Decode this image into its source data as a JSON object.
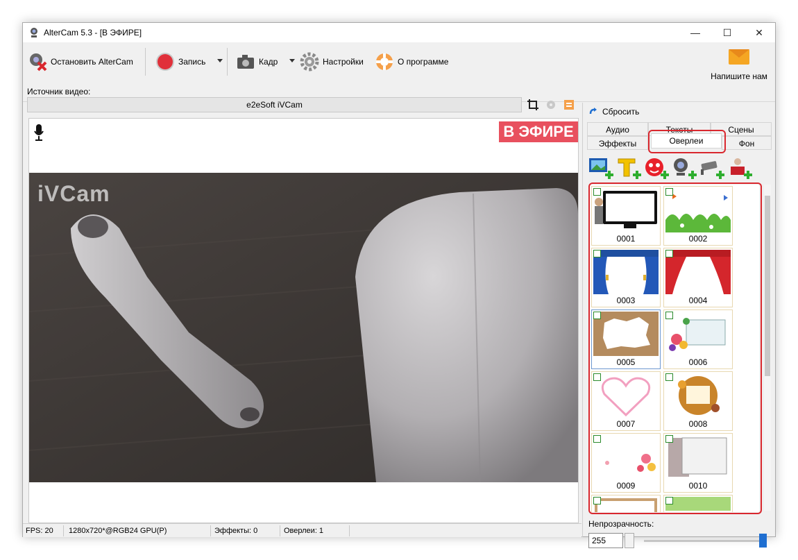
{
  "window": {
    "title": "AlterCam 5.3 - [В ЭФИРЕ]",
    "controls": {
      "minimize": "—",
      "maximize": "☐",
      "close": "✕"
    }
  },
  "toolbar": {
    "stop_label": "Остановить AlterCam",
    "record_label": "Запись",
    "frame_label": "Кадр",
    "settings_label": "Настройки",
    "about_label": "О программе",
    "mail_label": "Напишите нам"
  },
  "source": {
    "label": "Источник видео:",
    "value": "e2eSoft iVCam"
  },
  "preview": {
    "on_air_badge": "В ЭФИРЕ",
    "watermark": "iVCam"
  },
  "status": {
    "fps": "FPS: 20",
    "format": "1280x720*@RGB24 GPU(P)",
    "effects": "Эффекты: 0",
    "overlays": "Оверлеи: 1"
  },
  "panel": {
    "reset_label": "Сбросить",
    "tabs_row1": [
      "Аудио",
      "Тексты",
      "Сцены"
    ],
    "tabs_row2": [
      "Эффекты",
      "Оверлеи",
      "Фон"
    ],
    "active_tab": "Оверлеи",
    "overlays": [
      "0001",
      "0002",
      "0003",
      "0004",
      "0005",
      "0006",
      "0007",
      "0008",
      "0009",
      "0010"
    ],
    "opacity_label": "Непрозрачность:",
    "opacity_value": "255",
    "opacity_level": 1.0
  },
  "colors": {
    "on_air": "#e8505e",
    "highlight": "#d9272e",
    "slider": "#1f6fd1"
  }
}
